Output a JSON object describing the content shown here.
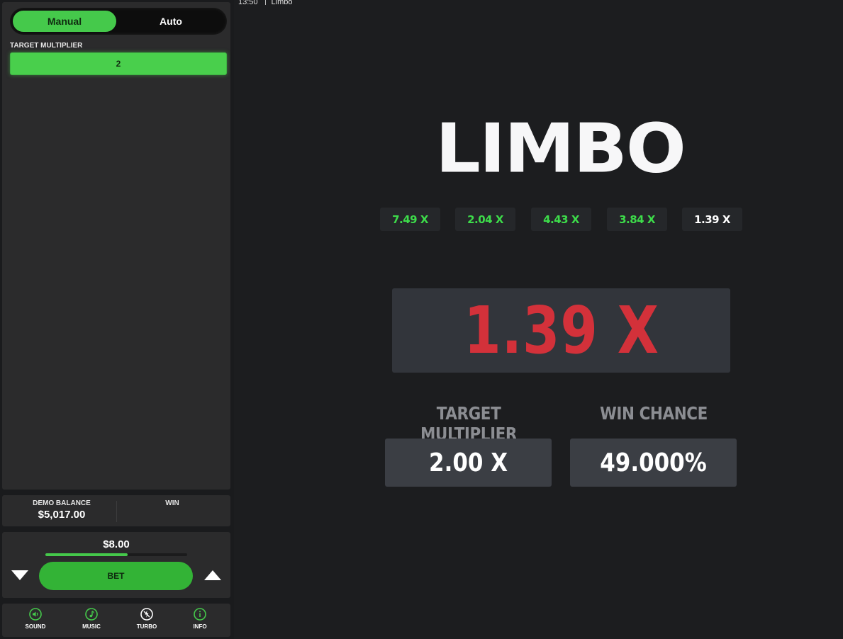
{
  "topbar": {
    "time": "13:50",
    "title": "Limbo"
  },
  "mode_toggle": {
    "manual": "Manual",
    "auto": "Auto",
    "selected": "Manual"
  },
  "config": {
    "target_label": "TARGET MULTIPLIER",
    "target_value": "2"
  },
  "balance": {
    "demo_label": "DEMO BALANCE",
    "demo_value": "$5,017.00",
    "win_label": "WIN"
  },
  "bet": {
    "amount": "$8.00",
    "button_label": "BET",
    "slider_fraction": 0.58
  },
  "footer": {
    "items": [
      {
        "label": "SOUND",
        "icon": "speaker-icon"
      },
      {
        "label": "MUSIC",
        "icon": "music-note-icon"
      },
      {
        "label": "TURBO",
        "icon": "turbo-icon"
      },
      {
        "label": "INFO",
        "icon": "info-icon"
      }
    ]
  },
  "game": {
    "logo": "LIMBO",
    "history": [
      {
        "value": "7.49 X",
        "color": "#3ddc4a"
      },
      {
        "value": "2.04 X",
        "color": "#3ddc4a"
      },
      {
        "value": "4.43 X",
        "color": "#3ddc4a"
      },
      {
        "value": "3.84 X",
        "color": "#3ddc4a"
      },
      {
        "value": "1.39 X",
        "color": "#ffffff"
      }
    ],
    "result": "1.39 X",
    "result_color": "#d3313a",
    "target_label": "TARGET MULTIPLIER",
    "target_value": "2.00 X",
    "chance_label": "WIN CHANCE",
    "chance_value": "49.000%"
  },
  "colors": {
    "accent": "#45c94b",
    "panel": "#2b2b2c",
    "background": "#1c1d1f"
  }
}
